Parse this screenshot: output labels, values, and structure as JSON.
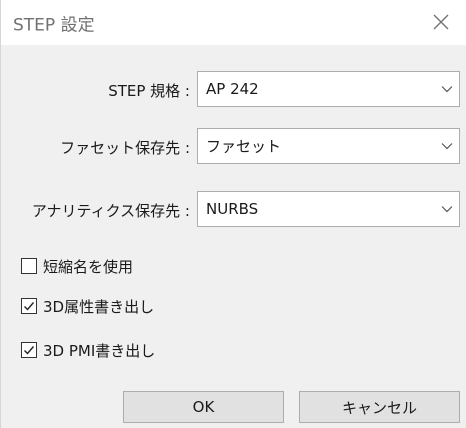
{
  "window": {
    "title": "STEP 設定",
    "close_icon": "close-icon"
  },
  "form": {
    "step_standard": {
      "label": "STEP 規格 :",
      "value": "AP 242"
    },
    "facet_dest": {
      "label": "ファセット保存先 :",
      "value": "ファセット"
    },
    "analytics_dest": {
      "label": "アナリティクス保存先 :",
      "value": "NURBS"
    }
  },
  "options": [
    {
      "label": "短縮名を使用",
      "checked": false
    },
    {
      "label": "3D属性書き出し",
      "checked": true
    },
    {
      "label": "3D PMI書き出し",
      "checked": true
    }
  ],
  "buttons": {
    "ok": "OK",
    "cancel": "キャンセル"
  },
  "colors": {
    "title_text": "#707070",
    "client_bg": "#f0f0f0",
    "button_bg": "#e1e1e1",
    "border": "#adadad"
  }
}
